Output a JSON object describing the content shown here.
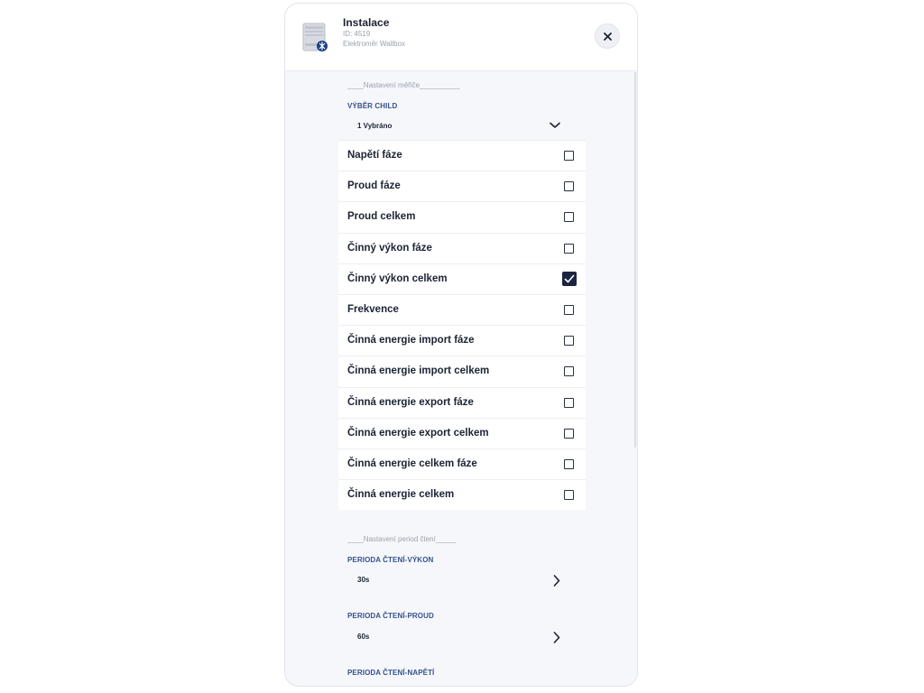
{
  "header": {
    "title": "Instalace",
    "id_text": "ID: 4519",
    "subtitle": "Elektroměr Wallbox"
  },
  "sections": {
    "meter_settings_label": "____Nastavení měřiče__________",
    "read_period_label": "____Nastavení period čtení_____"
  },
  "child_select": {
    "label": "VÝBĚR CHILD",
    "value": "1 Vybráno"
  },
  "items": [
    {
      "label": "Napětí fáze",
      "checked": false
    },
    {
      "label": "Proud fáze",
      "checked": false
    },
    {
      "label": "Proud celkem",
      "checked": false
    },
    {
      "label": "Činný výkon fáze",
      "checked": false
    },
    {
      "label": "Činný výkon celkem",
      "checked": true
    },
    {
      "label": "Frekvence",
      "checked": false
    },
    {
      "label": "Činná energie import fáze",
      "checked": false
    },
    {
      "label": "Činná energie import celkem",
      "checked": false
    },
    {
      "label": "Činná energie export fáze",
      "checked": false
    },
    {
      "label": "Činná energie export celkem",
      "checked": false
    },
    {
      "label": "Činná energie celkem fáze",
      "checked": false
    },
    {
      "label": "Činná energie celkem",
      "checked": false
    }
  ],
  "periods": [
    {
      "label": "PERIODA ČTENÍ-VÝKON",
      "value": "30s"
    },
    {
      "label": "PERIODA ČTENÍ-PROUD",
      "value": "60s"
    },
    {
      "label": "PERIODA ČTENÍ-NAPĚTÍ",
      "value": ""
    }
  ],
  "icons": {
    "close": "close-icon",
    "dropdown": "chevron-down-icon",
    "next": "chevron-right-icon",
    "checkbox": "checkbox-icon",
    "device": "device-image"
  },
  "colors": {
    "accent_label": "#34518c",
    "checkbox_checked": "#1c2540",
    "panel_bg": "#f6f7fb"
  }
}
